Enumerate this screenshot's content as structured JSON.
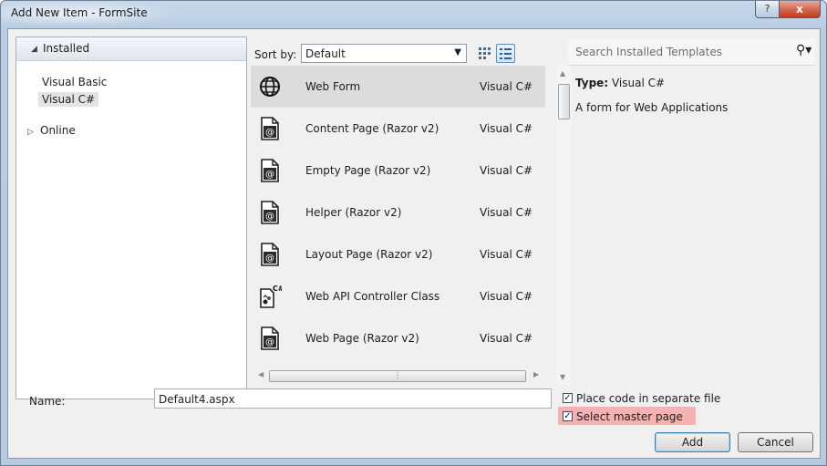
{
  "window": {
    "title": "Add New Item - FormSite",
    "help_label": "?",
    "close_label": "x"
  },
  "left_pane": {
    "installed_label": "Installed",
    "items": [
      {
        "label": "Visual Basic"
      },
      {
        "label": "Visual C#"
      }
    ],
    "online_label": "Online"
  },
  "toolbar": {
    "sort_label": "Sort by:",
    "sort_value": "Default"
  },
  "search": {
    "placeholder": "Search Installed Templates"
  },
  "templates": [
    {
      "name": "Web Form",
      "language": "Visual C#",
      "icon": "web-form-icon"
    },
    {
      "name": "Content Page (Razor v2)",
      "language": "Visual C#",
      "icon": "razor-page-icon"
    },
    {
      "name": "Empty Page (Razor v2)",
      "language": "Visual C#",
      "icon": "razor-page-icon"
    },
    {
      "name": "Helper (Razor v2)",
      "language": "Visual C#",
      "icon": "razor-page-icon"
    },
    {
      "name": "Layout Page (Razor v2)",
      "language": "Visual C#",
      "icon": "razor-page-icon"
    },
    {
      "name": "Web API Controller Class",
      "language": "Visual C#",
      "icon": "csharp-class-icon"
    },
    {
      "name": "Web Page (Razor v2)",
      "language": "Visual C#",
      "icon": "razor-page-icon"
    }
  ],
  "details": {
    "type_label": "Type:",
    "type_value": "Visual C#",
    "description": "A form for Web Applications"
  },
  "form": {
    "name_label": "Name:",
    "name_value": "Default4.aspx",
    "place_code_label": "Place code in separate file",
    "place_code_checked": true,
    "master_page_label": "Select master page",
    "master_page_checked": true,
    "check_mark": "✓"
  },
  "buttons": {
    "add": "Add",
    "cancel": "Cancel"
  },
  "colors": {
    "highlight": "#f6b2b2",
    "selected_row": "#dcdcdc"
  }
}
